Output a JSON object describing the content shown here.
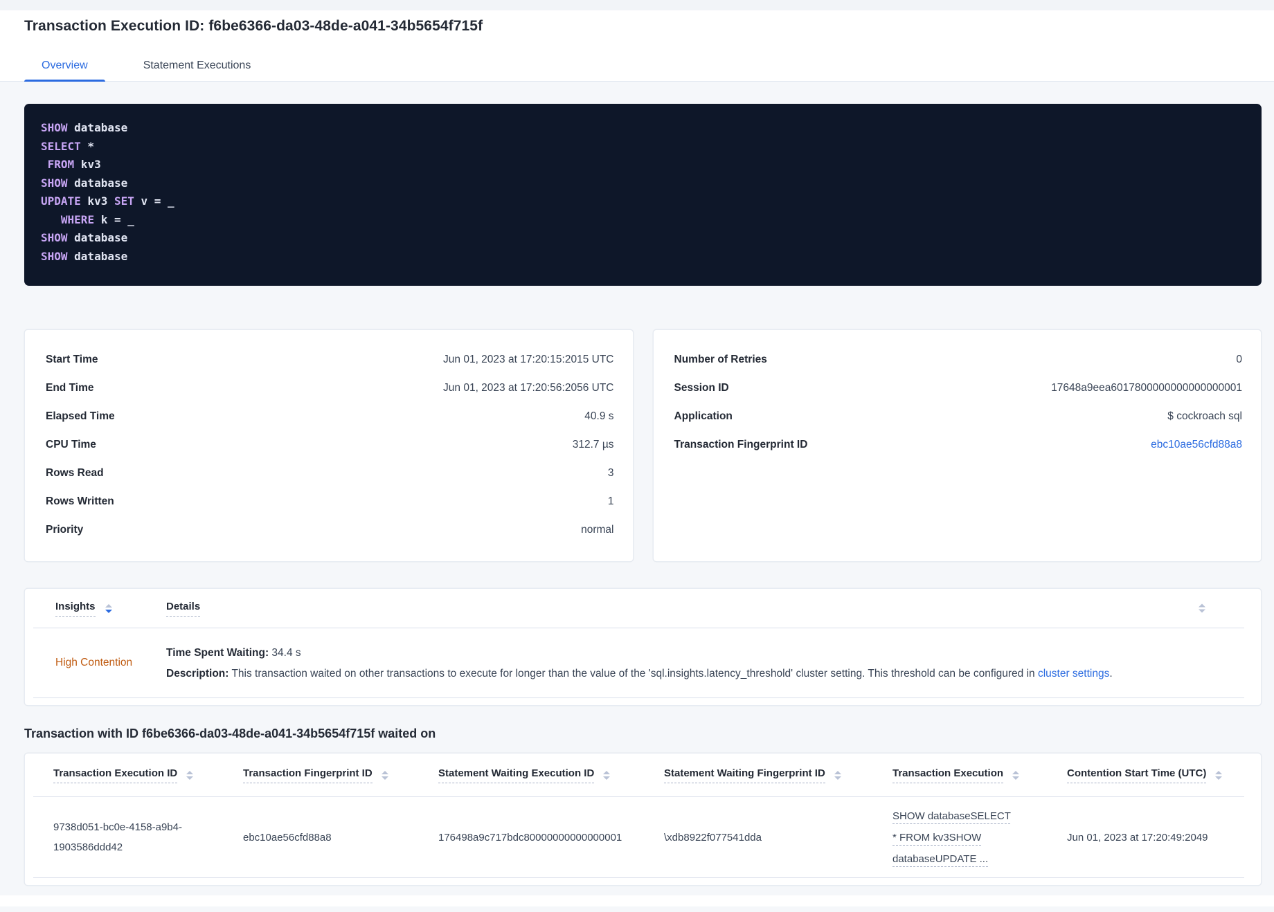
{
  "header": {
    "title": "Transaction Execution ID: f6be6366-da03-48de-a041-34b5654f715f",
    "tabs": [
      {
        "label": "Overview",
        "active": true
      },
      {
        "label": "Statement Executions",
        "active": false
      }
    ]
  },
  "sql": {
    "lines": [
      [
        {
          "t": "SHOW",
          "k": true
        },
        {
          "t": " database",
          "k": false
        }
      ],
      [
        {
          "t": "SELECT",
          "k": true
        },
        {
          "t": " *",
          "k": false
        }
      ],
      [
        {
          "t": " ",
          "k": false
        },
        {
          "t": "FROM",
          "k": true
        },
        {
          "t": " kv3",
          "k": false
        }
      ],
      [
        {
          "t": "SHOW",
          "k": true
        },
        {
          "t": " database",
          "k": false
        }
      ],
      [
        {
          "t": "UPDATE",
          "k": true
        },
        {
          "t": " kv3 ",
          "k": false
        },
        {
          "t": "SET",
          "k": true
        },
        {
          "t": " v = _",
          "k": false
        }
      ],
      [
        {
          "t": "   ",
          "k": false
        },
        {
          "t": "WHERE",
          "k": true
        },
        {
          "t": " k = _",
          "k": false
        }
      ],
      [
        {
          "t": "SHOW",
          "k": true
        },
        {
          "t": " database",
          "k": false
        }
      ],
      [
        {
          "t": "SHOW",
          "k": true
        },
        {
          "t": " database",
          "k": false
        }
      ]
    ]
  },
  "summary_left": {
    "rows": [
      {
        "label": "Start Time",
        "value": "Jun 01, 2023 at 17:20:15:2015 UTC"
      },
      {
        "label": "End Time",
        "value": "Jun 01, 2023 at 17:20:56:2056 UTC"
      },
      {
        "label": "Elapsed Time",
        "value": "40.9 s"
      },
      {
        "label": "CPU Time",
        "value": "312.7 µs"
      },
      {
        "label": "Rows Read",
        "value": "3"
      },
      {
        "label": "Rows Written",
        "value": "1"
      },
      {
        "label": "Priority",
        "value": "normal"
      }
    ]
  },
  "summary_right": {
    "rows": [
      {
        "label": "Number of Retries",
        "value": "0"
      },
      {
        "label": "Session ID",
        "value": "17648a9eea6017800000000000000001"
      },
      {
        "label": "Application",
        "value": "$ cockroach sql"
      },
      {
        "label": "Transaction Fingerprint ID",
        "value": "ebc10ae56cfd88a8"
      }
    ]
  },
  "insights": {
    "columns": {
      "insights": "Insights",
      "details": "Details"
    },
    "row": {
      "insight": "High Contention",
      "waiting_label": "Time Spent Waiting:",
      "waiting_value": " 34.4 s",
      "description_label": "Description:",
      "description_text": " This transaction waited on other transactions to execute for longer than the value of the 'sql.insights.latency_threshold' cluster setting. This threshold can be configured in ",
      "description_link": "cluster settings",
      "description_end": "."
    }
  },
  "waited_table": {
    "heading": "Transaction with ID f6be6366-da03-48de-a041-34b5654f715f waited on",
    "columns": [
      {
        "label": "Transaction Execution ID"
      },
      {
        "label": "Transaction Fingerprint ID"
      },
      {
        "label": "Statement Waiting Execution ID"
      },
      {
        "label": "Statement Waiting Fingerprint ID"
      },
      {
        "label": "Transaction Execution"
      },
      {
        "label": "Contention Start Time (UTC)"
      }
    ],
    "row": {
      "transaction_execution_id": "9738d051-bc0e-4158-a9b4-1903586ddd42",
      "transaction_fingerprint_id": "ebc10ae56cfd88a8",
      "statement_waiting_execution_id": "176498a9c717bdc80000000000000001",
      "statement_waiting_fingerprint_id": "\\xdb8922f077541dda",
      "transaction_execution": "SHOW databaseSELECT * FROM kv3SHOW databaseUPDATE ...",
      "contention_start_time": "Jun 01, 2023 at 17:20:49:2049"
    }
  },
  "colors": {
    "accent_blue": "#2b6be0",
    "high_contention_orange": "#c05c12",
    "code_background": "#0e1729",
    "code_keyword": "#c7a5f4"
  }
}
